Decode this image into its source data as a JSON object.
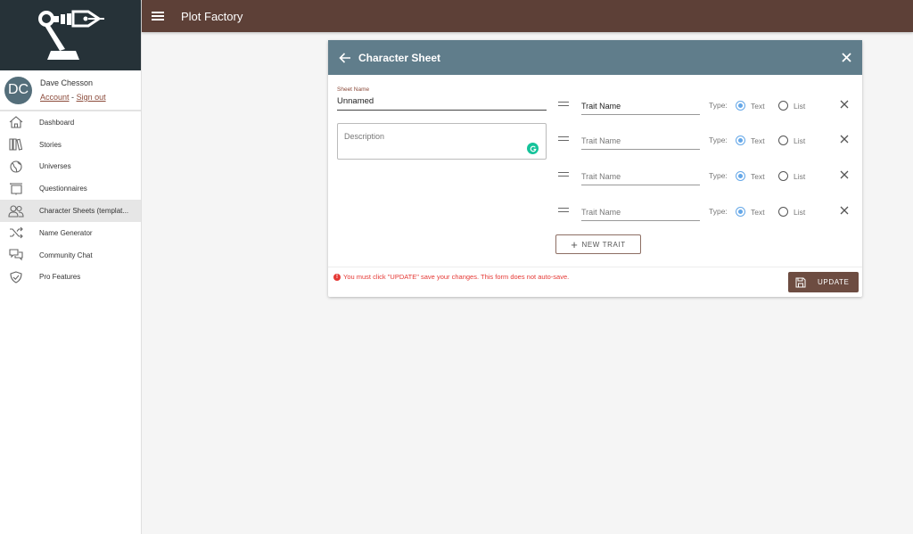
{
  "app": {
    "title": "Plot Factory"
  },
  "user": {
    "initials": "DC",
    "name": "Dave Chesson",
    "account_link": "Account",
    "separator": "-",
    "signout_link": "Sign out"
  },
  "sidebar": {
    "items": [
      {
        "label": "Dashboard",
        "icon": "home-icon",
        "active": false
      },
      {
        "label": "Stories",
        "icon": "books-icon",
        "active": false
      },
      {
        "label": "Universes",
        "icon": "globe-icon",
        "active": false
      },
      {
        "label": "Questionnaires",
        "icon": "presentation-icon",
        "active": false
      },
      {
        "label": "Character Sheets (templat...",
        "icon": "people-icon",
        "active": true
      },
      {
        "label": "Name Generator",
        "icon": "shuffle-icon",
        "active": false
      },
      {
        "label": "Community Chat",
        "icon": "chat-icon",
        "active": false
      },
      {
        "label": "Pro Features",
        "icon": "shield-check-icon",
        "active": false
      }
    ]
  },
  "card": {
    "title": "Character Sheet",
    "sheet_name_label": "Sheet Name",
    "sheet_name_value": "Unnamed",
    "description_placeholder": "Description",
    "traits": [
      {
        "value": "Trait Name",
        "placeholder": "Trait Name",
        "type_label": "Type:",
        "option_text": "Text",
        "option_list": "List",
        "selected": "Text"
      },
      {
        "value": "",
        "placeholder": "Trait Name",
        "type_label": "Type:",
        "option_text": "Text",
        "option_list": "List",
        "selected": "Text"
      },
      {
        "value": "",
        "placeholder": "Trait Name",
        "type_label": "Type:",
        "option_text": "Text",
        "option_list": "List",
        "selected": "Text"
      },
      {
        "value": "",
        "placeholder": "Trait Name",
        "type_label": "Type:",
        "option_text": "Text",
        "option_list": "List",
        "selected": "Text"
      }
    ],
    "new_trait_label": "NEW TRAIT",
    "warning_text": "You must click \"UPDATE\" save your changes. This form does not auto-save.",
    "update_label": "UPDATE"
  },
  "colors": {
    "topbar": "#5d4037",
    "card_header": "#607d8b",
    "update_button": "#6d4c41",
    "warning": "#e53935",
    "radio_selected": "#64a7e8",
    "link": "#8b4a3a"
  }
}
